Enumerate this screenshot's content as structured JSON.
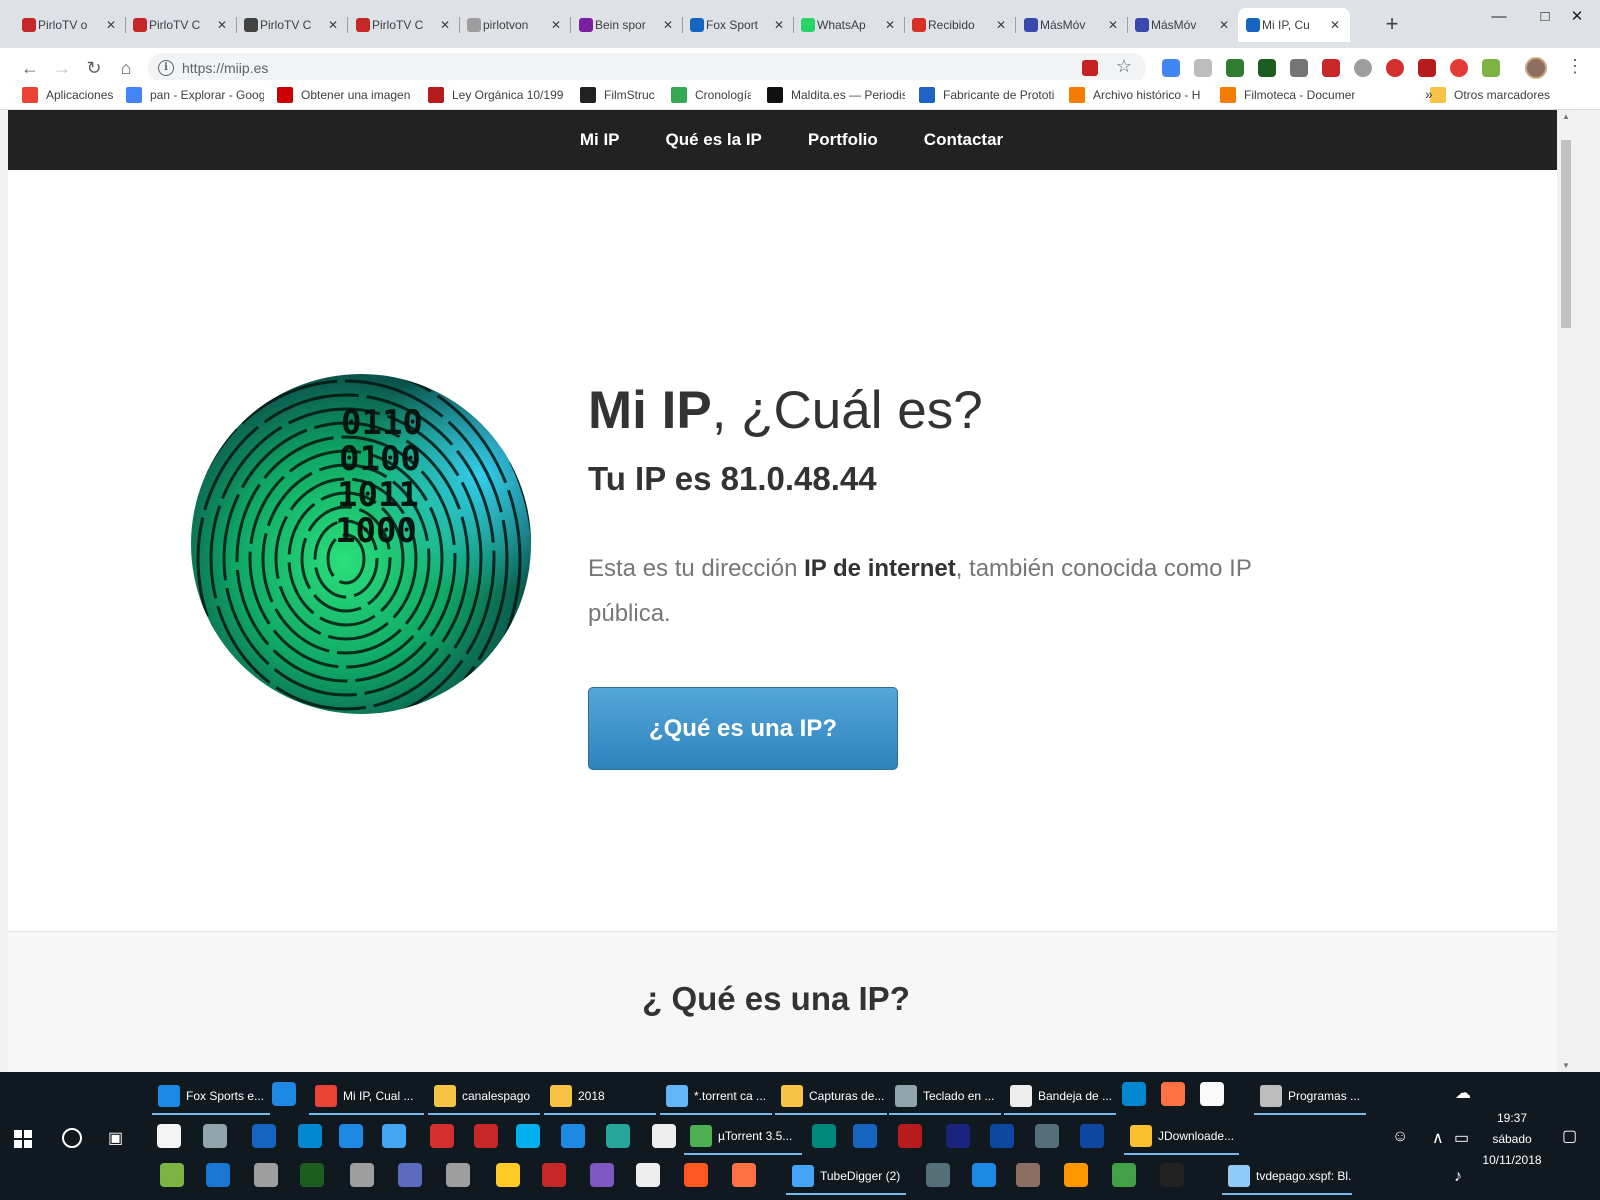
{
  "browser": {
    "tabs": [
      {
        "title": "PirloTV o",
        "icon": "pirlotv-icon",
        "color": "#c62828"
      },
      {
        "title": "PirloTV C",
        "icon": "pirlotv-icon",
        "color": "#c62828"
      },
      {
        "title": "PirloTV C",
        "icon": "soccer-ball-icon",
        "color": "#424242"
      },
      {
        "title": "PirloTV C",
        "icon": "pirlotv-icon",
        "color": "#c62828"
      },
      {
        "title": "pirlotvon",
        "icon": "document-icon",
        "color": "#9e9e9e"
      },
      {
        "title": "Bein spor",
        "icon": "bein-icon",
        "color": "#7b1fa2"
      },
      {
        "title": "Fox Sport",
        "icon": "fox-icon",
        "color": "#1565c0"
      },
      {
        "title": "WhatsAp",
        "icon": "whatsapp-icon",
        "color": "#25d366"
      },
      {
        "title": "Recibido",
        "icon": "gmail-icon",
        "color": "#d93025"
      },
      {
        "title": "MásMóv",
        "icon": "masmovil-icon",
        "color": "#3949ab"
      },
      {
        "title": "MásMóv",
        "icon": "masmovil-icon",
        "color": "#3949ab"
      },
      {
        "title": "Mi IP, Cu",
        "icon": "miip-icon",
        "color": "#1565c0"
      }
    ],
    "url": "https://miip.es",
    "bookmarks": [
      {
        "label": "Aplicaciones",
        "icon": "apps-grid-icon",
        "color": "#ea4335"
      },
      {
        "label": "pan - Explorar - Goog",
        "icon": "trends-icon",
        "color": "#4285f4"
      },
      {
        "label": "Obtener una imagen",
        "icon": "youtube-icon",
        "color": "#cc0000"
      },
      {
        "label": "Ley Orgánica 10/199",
        "icon": "feather-icon",
        "color": "#b71c1c"
      },
      {
        "label": "FilmStruck",
        "icon": "filmstruck-icon",
        "color": "#212121"
      },
      {
        "label": "Cronología",
        "icon": "maps-icon",
        "color": "#34a853"
      },
      {
        "label": "Maldita.es — Periodis",
        "icon": "maldita-icon",
        "color": "#111111"
      },
      {
        "label": "Fabricante de Prototi",
        "icon": "jlc-icon",
        "color": "#1e63c6"
      },
      {
        "label": "Archivo histórico - H",
        "icon": "rtve-icon",
        "color": "#f57c00"
      },
      {
        "label": "Filmoteca - Documen",
        "icon": "rtve-icon",
        "color": "#f57c00"
      },
      {
        "label": "Otros marcadores",
        "icon": "folder-icon",
        "color": "#f6c344"
      }
    ],
    "more_bookmarks": "»"
  },
  "site": {
    "nav": [
      "Mi IP",
      "Qué es la IP",
      "Portfolio",
      "Contactar"
    ],
    "hero": {
      "title_bold": "Mi IP",
      "title_rest": ", ¿Cuál es?",
      "ip_text": "Tu IP es 81.0.48.44",
      "desc_before": "Esta es tu dirección ",
      "desc_bold": "IP de internet",
      "desc_after": ", también conocida como IP pública.",
      "cta_label": "¿Qué es una IP?",
      "binary_lines": [
        "0110",
        "0100",
        "1011",
        "1000"
      ]
    },
    "section2_title": "¿ Qué es una IP?"
  },
  "taskbar": {
    "row1": [
      {
        "label": "Fox Sports e...",
        "icon": "ie-icon",
        "color": "#1e88e5"
      },
      {
        "label": "Mi IP, Cual ...",
        "icon": "chrome-icon",
        "color": "#ea4335"
      },
      {
        "label": "canalespago",
        "icon": "folder-icon",
        "color": "#f6c344"
      },
      {
        "label": "2018",
        "icon": "folder-icon",
        "color": "#f6c344"
      },
      {
        "label": "*.torrent ca ...",
        "icon": "cube-icon",
        "color": "#64b5f6"
      },
      {
        "label": "Capturas de...",
        "icon": "folder-icon",
        "color": "#f6c344"
      },
      {
        "label": "Teclado en ...",
        "icon": "keyboard-icon",
        "color": "#90a4ae"
      },
      {
        "label": "Bandeja de ...",
        "icon": "mail-icon",
        "color": "#eeeeee"
      },
      {
        "label": "Programas ...",
        "icon": "installer-icon",
        "color": "#bdbdbd"
      }
    ],
    "row2": [
      {
        "label": "µTorrent 3.5...",
        "icon": "utorrent-icon",
        "color": "#4caf50"
      },
      {
        "label": "JDownloade...",
        "icon": "jdownloader-icon",
        "color": "#fbc02d"
      }
    ],
    "row3": [
      {
        "label": "TubeDigger (2)",
        "icon": "tubedigger-icon",
        "color": "#42a5f5"
      },
      {
        "label": "tvdepago.xspf: Bl...",
        "icon": "notepad-icon",
        "color": "#90caf9"
      }
    ],
    "clock_time": "19:37",
    "clock_day": "sábado",
    "clock_date": "10/11/2018"
  },
  "colors": {
    "accent_button": "#428bca",
    "nav_bg": "#222222",
    "fingerprint": "#22c55e"
  }
}
